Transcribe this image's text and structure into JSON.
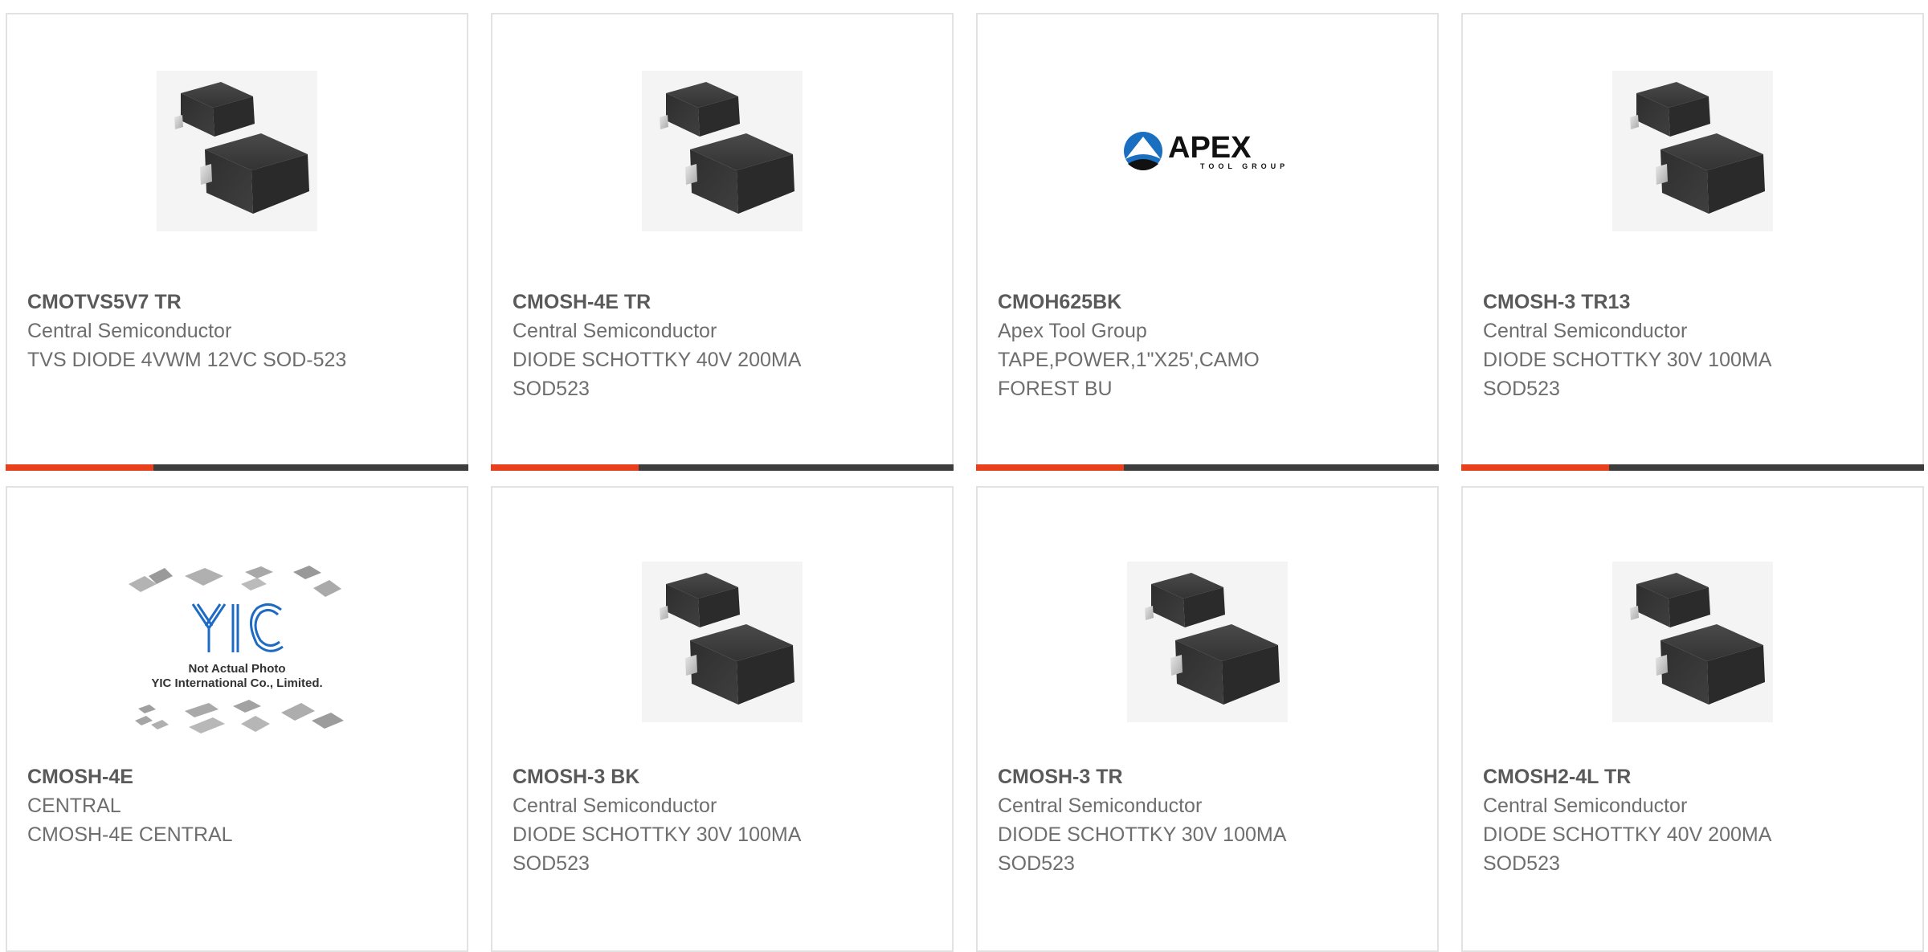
{
  "colors": {
    "accent": "#e8401c",
    "bar": "#3d3d3d",
    "title": "#5a5a5a",
    "text": "#6e6e6e",
    "border": "#e2e2e2"
  },
  "products": [
    {
      "part": "CMOTVS5V7 TR",
      "manufacturer": "Central Semiconductor",
      "description": "TVS DIODE 4VWM 12VC SOD-523",
      "image": "diode-package-icon"
    },
    {
      "part": "CMOSH-4E TR",
      "manufacturer": "Central Semiconductor",
      "description": "DIODE SCHOTTKY 40V 200MA SOD523",
      "image": "diode-package-icon"
    },
    {
      "part": "CMOH625BK",
      "manufacturer": "Apex Tool Group",
      "description": "TAPE,POWER,1\"X25',CAMO FOREST BU",
      "image": "apex-logo",
      "logo_text": "APEX",
      "logo_subtext": "TOOL GROUP"
    },
    {
      "part": "CMOSH-3 TR13",
      "manufacturer": "Central Semiconductor",
      "description": "DIODE SCHOTTKY 30V 100MA SOD523",
      "image": "diode-package-icon"
    },
    {
      "part": "CMOSH-4E",
      "manufacturer": "CENTRAL",
      "description": "CMOSH-4E CENTRAL",
      "image": "yic-placeholder",
      "logo_text": "YIC",
      "photo_note_1": "Not Actual Photo",
      "photo_note_2": "YIC International Co., Limited."
    },
    {
      "part": "CMOSH-3 BK",
      "manufacturer": "Central Semiconductor",
      "description": "DIODE SCHOTTKY 30V 100MA SOD523",
      "image": "diode-package-icon"
    },
    {
      "part": "CMOSH-3 TR",
      "manufacturer": "Central Semiconductor",
      "description": "DIODE SCHOTTKY 30V 100MA SOD523",
      "image": "diode-package-icon"
    },
    {
      "part": "CMOSH2-4L TR",
      "manufacturer": "Central Semiconductor",
      "description": "DIODE SCHOTTKY 40V 200MA SOD523",
      "image": "diode-package-icon"
    }
  ]
}
